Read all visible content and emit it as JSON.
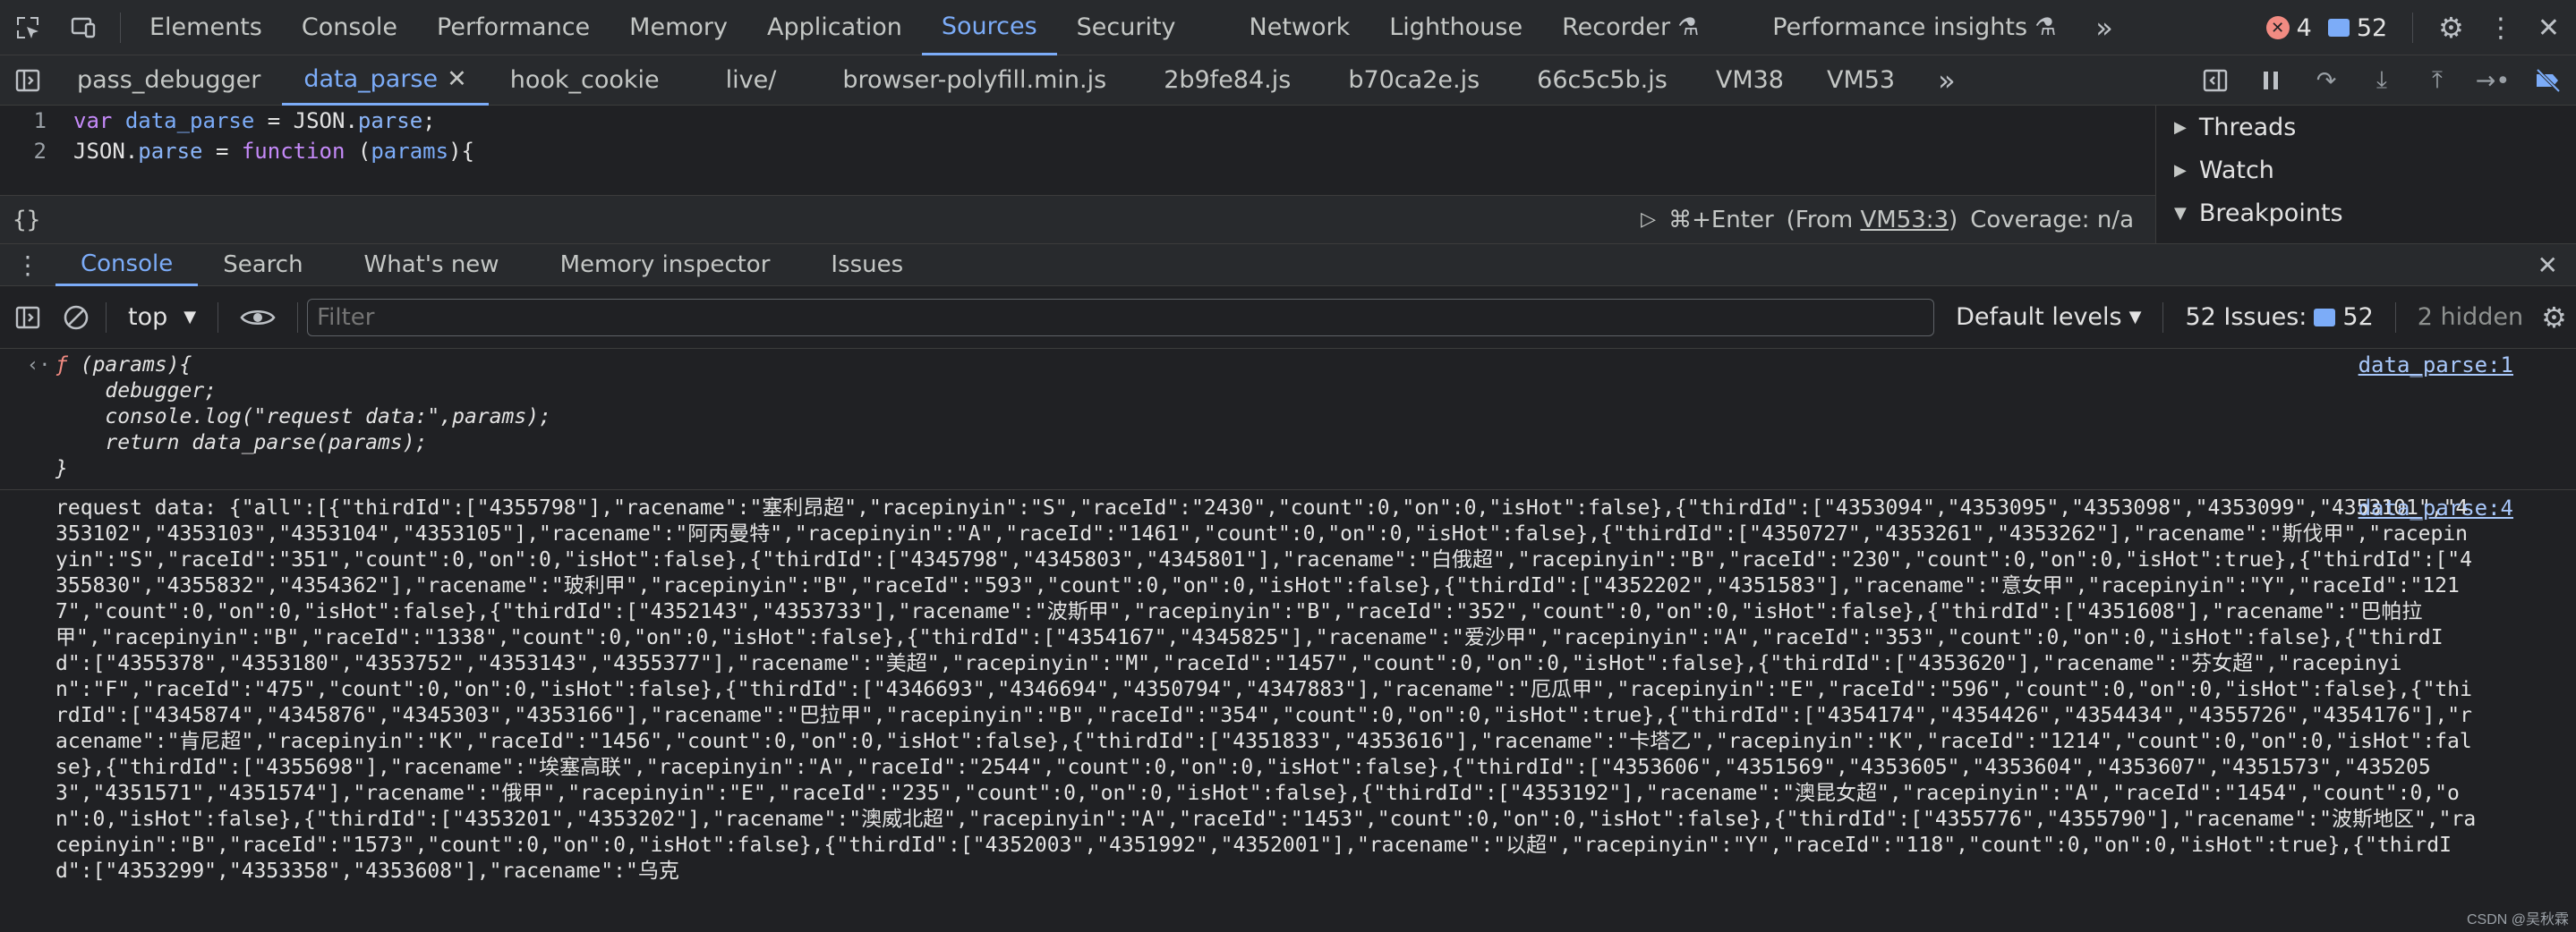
{
  "toolbar": {
    "tabs": [
      "Elements",
      "Console",
      "Performance",
      "Memory",
      "Application",
      "Sources",
      "Security",
      "Network",
      "Lighthouse",
      "Recorder",
      "Performance insights"
    ],
    "errors_count": "4",
    "messages_count": "52",
    "more_tabs_glyph": "»"
  },
  "filetabs": {
    "items": [
      "pass_debugger",
      "data_parse",
      "hook_cookie",
      "live/",
      "browser-polyfill.min.js",
      "2b9fe84.js",
      "b70ca2e.js",
      "66c5c5b.js",
      "VM38",
      "VM53"
    ],
    "more_glyph": "»"
  },
  "editor": {
    "line_numbers": [
      "1",
      "2"
    ],
    "line1": {
      "kw": "var",
      "name": "data_parse",
      "eq": " = JSON.",
      "prop": "parse",
      "end": ";"
    },
    "line2": {
      "obj": "JSON.",
      "prop": "parse",
      "eq": " = ",
      "kw": "function",
      "args_open": " (",
      "arg": "params",
      "args_close": "){"
    }
  },
  "editorstatus": {
    "braces": "{}",
    "run_hint": "⌘+Enter",
    "from_prefix": "(From ",
    "from_link": "VM53:3",
    "from_suffix": ")",
    "coverage": "Coverage: n/a"
  },
  "sidepane": {
    "sections": [
      "Threads",
      "Watch",
      "Breakpoints"
    ]
  },
  "drawer": {
    "tabs": [
      "Console",
      "Search",
      "What's new",
      "Memory inspector",
      "Issues"
    ]
  },
  "console_toolbar": {
    "context": "top",
    "filter_placeholder": "Filter",
    "levels": "Default levels",
    "issues_label": "52 Issues:",
    "issues_count": "52",
    "hidden": "2 hidden"
  },
  "console": {
    "fn_source": "data_parse:1",
    "fn_lines": [
      "(params){",
      "    debugger;",
      "    console.log(\"request data:\",params);",
      "    return data_parse(params);",
      "}"
    ],
    "fn_glyph": "ƒ",
    "req_source": "data_parse:4",
    "request_text": "request data: {\"all\":[{\"thirdId\":[\"4355798\"],\"racename\":\"塞利昂超\",\"racepinyin\":\"S\",\"raceId\":\"2430\",\"count\":0,\"on\":0,\"isHot\":false},{\"thirdId\":[\"4353094\",\"4353095\",\"4353098\",\"4353099\",\"4353101\",\"4353102\",\"4353103\",\"4353104\",\"4353105\"],\"racename\":\"阿丙曼特\",\"racepinyin\":\"A\",\"raceId\":\"1461\",\"count\":0,\"on\":0,\"isHot\":false},{\"thirdId\":[\"4350727\",\"4353261\",\"4353262\"],\"racename\":\"斯伐甲\",\"racepinyin\":\"S\",\"raceId\":\"351\",\"count\":0,\"on\":0,\"isHot\":false},{\"thirdId\":[\"4345798\",\"4345803\",\"4345801\"],\"racename\":\"白俄超\",\"racepinyin\":\"B\",\"raceId\":\"230\",\"count\":0,\"on\":0,\"isHot\":true},{\"thirdId\":[\"4355830\",\"4355832\",\"4354362\"],\"racename\":\"玻利甲\",\"racepinyin\":\"B\",\"raceId\":\"593\",\"count\":0,\"on\":0,\"isHot\":false},{\"thirdId\":[\"4352202\",\"4351583\"],\"racename\":\"意女甲\",\"racepinyin\":\"Y\",\"raceId\":\"1217\",\"count\":0,\"on\":0,\"isHot\":false},{\"thirdId\":[\"4352143\",\"4353733\"],\"racename\":\"波斯甲\",\"racepinyin\":\"B\",\"raceId\":\"352\",\"count\":0,\"on\":0,\"isHot\":false},{\"thirdId\":[\"4351608\"],\"racename\":\"巴帕拉甲\",\"racepinyin\":\"B\",\"raceId\":\"1338\",\"count\":0,\"on\":0,\"isHot\":false},{\"thirdId\":[\"4354167\",\"4345825\"],\"racename\":\"爱沙甲\",\"racepinyin\":\"A\",\"raceId\":\"353\",\"count\":0,\"on\":0,\"isHot\":false},{\"thirdId\":[\"4355378\",\"4353180\",\"4353752\",\"4353143\",\"4355377\"],\"racename\":\"美超\",\"racepinyin\":\"M\",\"raceId\":\"1457\",\"count\":0,\"on\":0,\"isHot\":false},{\"thirdId\":[\"4353620\"],\"racename\":\"芬女超\",\"racepinyin\":\"F\",\"raceId\":\"475\",\"count\":0,\"on\":0,\"isHot\":false},{\"thirdId\":[\"4346693\",\"4346694\",\"4350794\",\"4347883\"],\"racename\":\"厄瓜甲\",\"racepinyin\":\"E\",\"raceId\":\"596\",\"count\":0,\"on\":0,\"isHot\":false},{\"thirdId\":[\"4345874\",\"4345876\",\"4345303\",\"4353166\"],\"racename\":\"巴拉甲\",\"racepinyin\":\"B\",\"raceId\":\"354\",\"count\":0,\"on\":0,\"isHot\":true},{\"thirdId\":[\"4354174\",\"4354426\",\"4354434\",\"4355726\",\"4354176\"],\"racename\":\"肯尼超\",\"racepinyin\":\"K\",\"raceId\":\"1456\",\"count\":0,\"on\":0,\"isHot\":false},{\"thirdId\":[\"4351833\",\"4353616\"],\"racename\":\"卡塔乙\",\"racepinyin\":\"K\",\"raceId\":\"1214\",\"count\":0,\"on\":0,\"isHot\":false},{\"thirdId\":[\"4355698\"],\"racename\":\"埃塞高联\",\"racepinyin\":\"A\",\"raceId\":\"2544\",\"count\":0,\"on\":0,\"isHot\":false},{\"thirdId\":[\"4353606\",\"4351569\",\"4353605\",\"4353604\",\"4353607\",\"4351573\",\"4352053\",\"4351571\",\"4351574\"],\"racename\":\"俄甲\",\"racepinyin\":\"E\",\"raceId\":\"235\",\"count\":0,\"on\":0,\"isHot\":false},{\"thirdId\":[\"4353192\"],\"racename\":\"澳昆女超\",\"racepinyin\":\"A\",\"raceId\":\"1454\",\"count\":0,\"on\":0,\"isHot\":false},{\"thirdId\":[\"4353201\",\"4353202\"],\"racename\":\"澳威北超\",\"racepinyin\":\"A\",\"raceId\":\"1453\",\"count\":0,\"on\":0,\"isHot\":false},{\"thirdId\":[\"4355776\",\"4355790\"],\"racename\":\"波斯地区\",\"racepinyin\":\"B\",\"raceId\":\"1573\",\"count\":0,\"on\":0,\"isHot\":false},{\"thirdId\":[\"4352003\",\"4351992\",\"4352001\"],\"racename\":\"以超\",\"racepinyin\":\"Y\",\"raceId\":\"118\",\"count\":0,\"on\":0,\"isHot\":true},{\"thirdId\":[\"4353299\",\"4353358\",\"4353608\"],\"racename\":\"乌克"
  },
  "watermark": "CSDN @吴秋霖"
}
